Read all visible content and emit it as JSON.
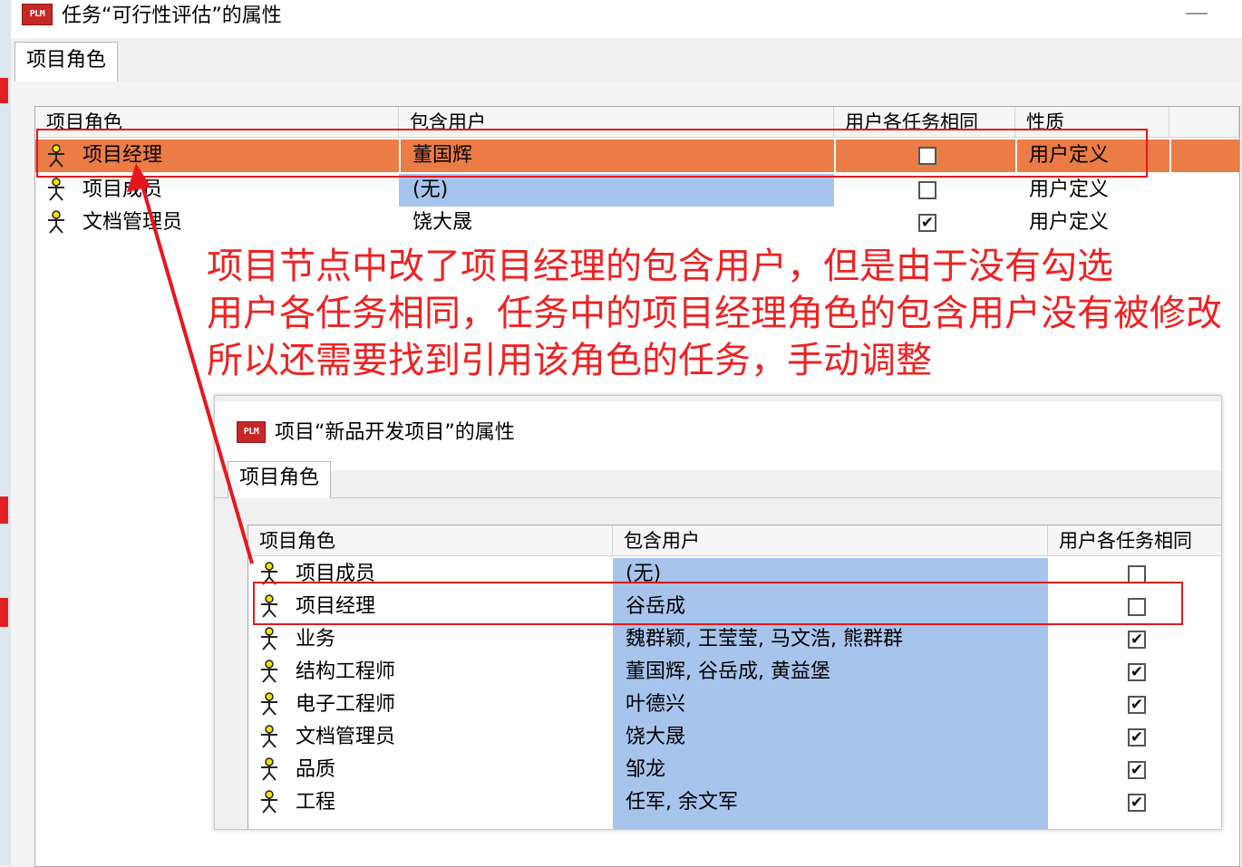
{
  "window1": {
    "title": "任务“可行性评估”的属性",
    "logo": "PLM",
    "tab_label": "项目角色",
    "columns": [
      "项目角色",
      "包含用户",
      "用户各任务相同",
      "性质"
    ],
    "rows": [
      {
        "role": "项目经理",
        "users": "董国辉",
        "same_for_tasks": false,
        "nature": "用户定义",
        "selected": true
      },
      {
        "role": "项目成员",
        "users": "(无)",
        "same_for_tasks": false,
        "nature": "用户定义",
        "selected": false
      },
      {
        "role": "文档管理员",
        "users": "饶大晟",
        "same_for_tasks": true,
        "nature": "用户定义",
        "selected": false
      }
    ]
  },
  "annotation": {
    "lines": [
      "项目节点中改了项目经理的包含用户，但是由于没有勾选",
      "用户各任务相同，任务中的项目经理角色的包含用户没有被修改",
      "所以还需要找到引用该角色的任务，手动调整"
    ],
    "color": "#ee2222"
  },
  "window2": {
    "title": "项目“新品开发项目”的属性",
    "logo": "PLM",
    "tab_label": "项目角色",
    "columns": [
      "项目角色",
      "包含用户",
      "用户各任务相同"
    ],
    "rows": [
      {
        "role": "项目成员",
        "users": "(无)",
        "same_for_tasks": false
      },
      {
        "role": "项目经理",
        "users": "谷岳成",
        "same_for_tasks": false
      },
      {
        "role": "业务",
        "users": "魏群颖, 王莹莹, 马文浩, 熊群群",
        "same_for_tasks": true
      },
      {
        "role": "结构工程师",
        "users": "董国辉, 谷岳成, 黄益堡",
        "same_for_tasks": true
      },
      {
        "role": "电子工程师",
        "users": "叶德兴",
        "same_for_tasks": true
      },
      {
        "role": "文档管理员",
        "users": "饶大晟",
        "same_for_tasks": true
      },
      {
        "role": "品质",
        "users": "邹龙",
        "same_for_tasks": true
      },
      {
        "role": "工程",
        "users": "任军, 余文军",
        "same_for_tasks": true
      }
    ]
  },
  "colors": {
    "selection": "#ec7c45",
    "users_column": "#a7c4ec",
    "highlight_box": "#e8161b"
  },
  "icons": {
    "role_icon": "person-icon",
    "checkbox_checked": "✔"
  }
}
